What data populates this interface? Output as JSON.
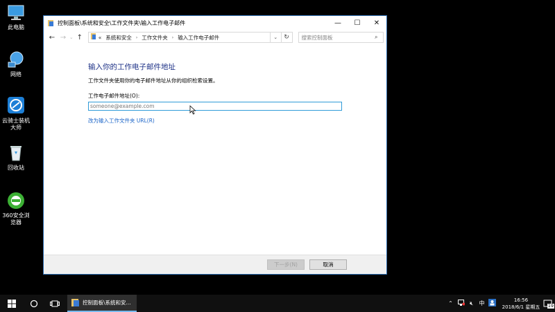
{
  "desktop": {
    "icons": [
      {
        "label": "此电脑",
        "icon": "this-pc-icon"
      },
      {
        "label": "网络",
        "icon": "network-icon"
      },
      {
        "label": "云骑士装机大师",
        "icon": "cloud-knight-icon"
      },
      {
        "label": "回收站",
        "icon": "recycle-bin-icon"
      },
      {
        "label": "360安全浏览器",
        "icon": "360-browser-icon"
      }
    ]
  },
  "window": {
    "title": "控制面板\\系统和安全\\工作文件夹\\输入工作电子邮件",
    "address": {
      "overflow": "«",
      "crumbs": [
        "系统和安全",
        "工作文件夹",
        "输入工作电子邮件"
      ]
    },
    "search_placeholder": "搜索控制面板",
    "heading": "输入你的工作电子邮件地址",
    "description": "工作文件夹使用你的电子邮件地址从你的组织检索设置。",
    "email_label": "工作电子邮件地址(O):",
    "email_placeholder": "someone@example.com",
    "alt_link": "改为输入工作文件夹 URL(R)",
    "next_button": "下一步(N)",
    "cancel_button": "取消"
  },
  "taskbar": {
    "app_label": "控制面板\\系统和安...",
    "ime": "中",
    "time": "16:56",
    "date": "2018/6/1 星期五",
    "notification_count": "19"
  },
  "colors": {
    "accent": "#2e9bd8",
    "heading": "#1e3287",
    "link": "#1a64c8"
  }
}
